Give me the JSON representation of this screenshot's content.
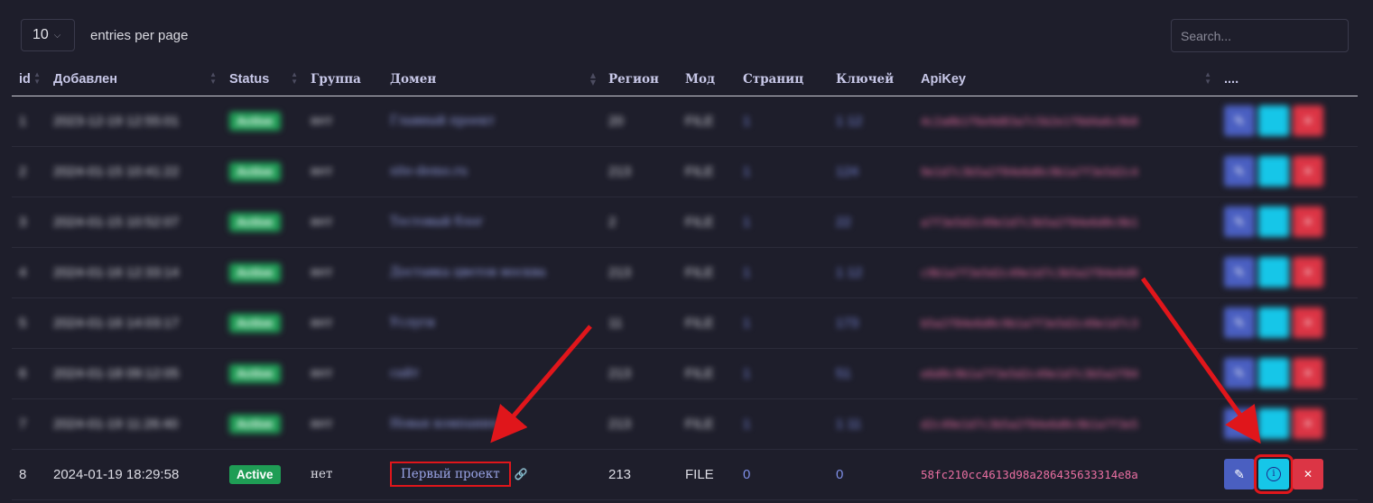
{
  "controls": {
    "per_page_value": "10",
    "per_page_label": "entries per page",
    "search_placeholder": "Search..."
  },
  "columns": [
    "id",
    "Добавлен",
    "Status",
    "Группа",
    "Домен",
    "Регион",
    "Мод",
    "Страниц",
    "Ключей",
    "ApiKey",
    "...."
  ],
  "blurred_rows": [
    {
      "id": "1",
      "added": "2023-12-19 12:55:01",
      "status": "Active",
      "group": "нет",
      "domain": "Главный проект",
      "region": "20",
      "mod": "FILE",
      "pages": "1",
      "keys": "1 12",
      "apikey": "4c2a0b1f6e9d83a7c5b2e1f0d4a6c9b8"
    },
    {
      "id": "2",
      "added": "2024-01-15 10:41:22",
      "status": "Active",
      "group": "нет",
      "domain": "site-demo.ru",
      "region": "213",
      "mod": "FILE",
      "pages": "1",
      "keys": "124",
      "apikey": "9e1d7c3b5a2f84e6d0c9b1a7f3e5d2c4"
    },
    {
      "id": "3",
      "added": "2024-01-15 10:52:07",
      "status": "Active",
      "group": "нет",
      "domain": "Тестовый блог",
      "region": "2",
      "mod": "FILE",
      "pages": "1",
      "keys": "22",
      "apikey": "a7f3e5d2c49e1d7c3b5a2f84e6d0c9b1"
    },
    {
      "id": "4",
      "added": "2024-01-16 12:33:14",
      "status": "Active",
      "group": "нет",
      "domain": "Доставка цветов москва",
      "region": "213",
      "mod": "FILE",
      "pages": "1",
      "keys": "1 12",
      "apikey": "c9b1a7f3e5d2c49e1d7c3b5a2f84e6d0"
    },
    {
      "id": "5",
      "added": "2024-01-16 14:03:17",
      "status": "Active",
      "group": "нет",
      "domain": "Услуги",
      "region": "11",
      "mod": "FILE",
      "pages": "1",
      "keys": "173",
      "apikey": "b5a2f84e6d0c9b1a7f3e5d2c49e1d7c3"
    },
    {
      "id": "6",
      "added": "2024-01-18 09:12:05",
      "status": "Active",
      "group": "нет",
      "domain": "сайт",
      "region": "213",
      "mod": "FILE",
      "pages": "1",
      "keys": "51",
      "apikey": "e6d0c9b1a7f3e5d2c49e1d7c3b5a2f84"
    },
    {
      "id": "7",
      "added": "2024-01-19 11:26:40",
      "status": "Active",
      "group": "нет",
      "domain": "Новая компания",
      "region": "213",
      "mod": "FILE",
      "pages": "1",
      "keys": "1 11",
      "apikey": "d2c49e1d7c3b5a2f84e6d0c9b1a7f3e5"
    }
  ],
  "row8": {
    "id": "8",
    "added": "2024-01-19 18:29:58",
    "status": "Active",
    "group": "нет",
    "domain": "Первый проект",
    "region": "213",
    "mod": "FILE",
    "pages": "0",
    "keys": "0",
    "apikey": "58fc210cc4613d98a286435633314e8a"
  },
  "icons": {
    "edit": "pencil-icon",
    "info": "info-icon",
    "delete": "close-icon",
    "link": "link-icon",
    "sort": "sort-icon"
  },
  "colors": {
    "background": "#1e1e2b",
    "active_badge": "#1f9d55",
    "edit_button": "#4a5fc1",
    "info_button": "#16c6e8",
    "delete_button": "#dc3545",
    "apikey_text": "#ea6fa2",
    "annotation": "#e0161b"
  }
}
